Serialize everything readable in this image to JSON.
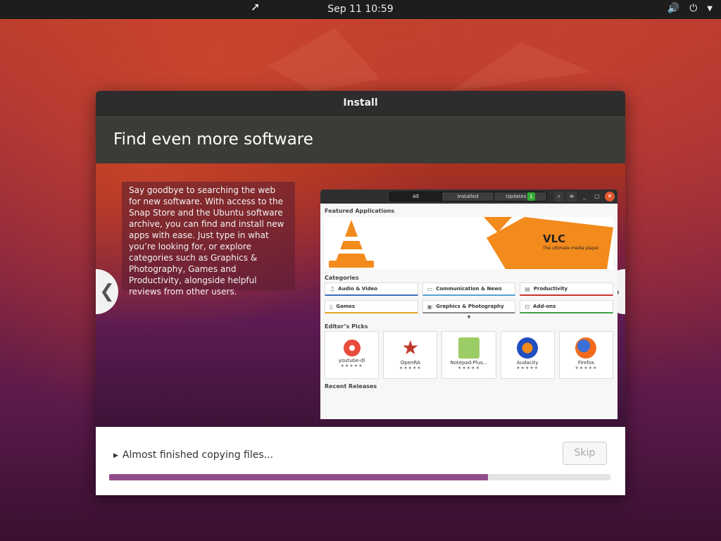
{
  "topbar": {
    "clock": "Sep 11  10:59",
    "icons": [
      "volume-icon",
      "power-icon",
      "dropdown-arrow-icon"
    ]
  },
  "window": {
    "title": "Install",
    "heading": "Find even more software",
    "description": "Say goodbye to searching the web for new software. With access to the Snap Store and the Ubuntu software archive, you can find and install new apps with ease. Just type in what you’re looking for, or explore categories such as Graphics & Photography, Games and Productivity, alongside helpful reviews from other users.",
    "nav_prev": "❮",
    "nav_next": "❯"
  },
  "app_screenshot": {
    "tabs": [
      {
        "label": "All",
        "active": true
      },
      {
        "label": "Installed",
        "active": false
      },
      {
        "label": "Updates",
        "active": false,
        "badge": "1"
      }
    ],
    "featured_heading": "Featured Applications",
    "featured": {
      "title": "VLC",
      "subtitle": "The ultimate media player"
    },
    "categories_heading": "Categories",
    "categories": [
      {
        "label": "Audio & Video",
        "icon": "music-note-icon",
        "color": "#3b6fb6"
      },
      {
        "label": "Communication & News",
        "icon": "chat-icon",
        "color": "#58a0d6"
      },
      {
        "label": "Productivity",
        "icon": "document-icon",
        "color": "#c7342f"
      },
      {
        "label": "Games",
        "icon": "game-icon",
        "color": "#e0a420"
      },
      {
        "label": "Graphics & Photography",
        "icon": "image-icon",
        "color": "#8a8a8a"
      },
      {
        "label": "Add-ons",
        "icon": "puzzle-icon",
        "color": "#3fa045"
      }
    ],
    "picks_heading": "Editor’s Picks",
    "picks": [
      {
        "name": "youtube-dl",
        "stars": "★★★★★",
        "icon": "youtube-dl-icon",
        "color": "#e74c3c"
      },
      {
        "name": "OpenRA",
        "stars": "★★★★★",
        "icon": "openra-icon",
        "color": "#c0392b"
      },
      {
        "name": "Notepad-Plus...",
        "stars": "★★★★★",
        "icon": "notepad-plus-icon",
        "color": "#8bc34a"
      },
      {
        "name": "Audacity",
        "stars": "★★★★★",
        "icon": "audacity-icon",
        "color": "#1f4fbf"
      },
      {
        "name": "Firefox",
        "stars": "★★★★★",
        "icon": "firefox-icon",
        "color": "#f26b1d"
      }
    ],
    "recent_heading": "Recent Releases"
  },
  "bottom": {
    "status": "Almost finished copying files...",
    "skip_label": "Skip",
    "progress": 0.755,
    "progress_color": "#924d8b"
  }
}
